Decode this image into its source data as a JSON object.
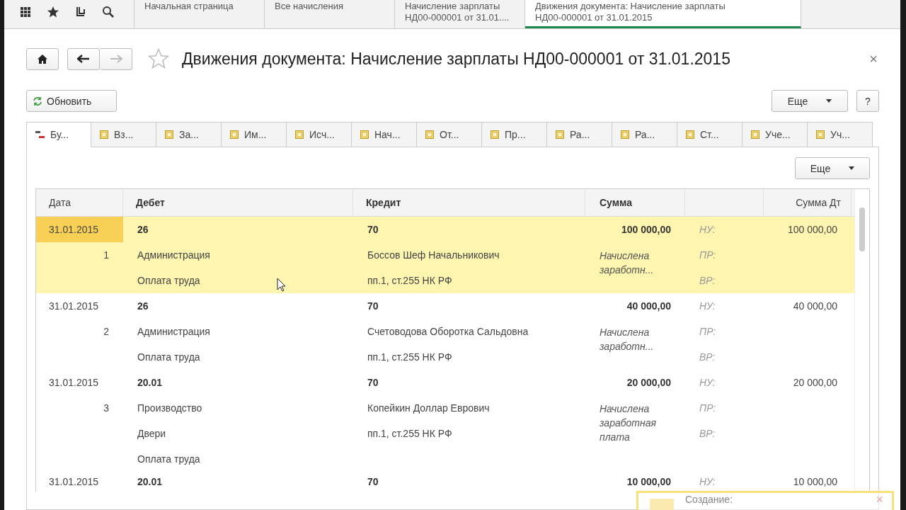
{
  "top_tabs": [
    {
      "lines": [
        "Начальная страница"
      ],
      "selected": false
    },
    {
      "lines": [
        "Все начисления"
      ],
      "selected": false
    },
    {
      "lines": [
        "Начисление зарплаты",
        "НД00-000001 от 31.01...."
      ],
      "selected": false
    },
    {
      "lines": [
        "Движения документа: Начисление зарплаты",
        "НД00-000001 от 31.01.2015"
      ],
      "selected": true
    }
  ],
  "window": {
    "title": "Движения документа: Начисление зарплаты НД00-000001 от 31.01.2015",
    "close": "×"
  },
  "toolbar": {
    "refresh": "Обновить",
    "more": "Еще",
    "help": "?"
  },
  "register_tabs": [
    {
      "label": "Бу...",
      "kind": "accounting",
      "selected": true
    },
    {
      "label": "Вз...",
      "kind": "register",
      "selected": false
    },
    {
      "label": "За...",
      "kind": "register",
      "selected": false
    },
    {
      "label": "Им...",
      "kind": "register",
      "selected": false
    },
    {
      "label": "Исч...",
      "kind": "register",
      "selected": false
    },
    {
      "label": "Нач...",
      "kind": "register",
      "selected": false
    },
    {
      "label": "От...",
      "kind": "register",
      "selected": false
    },
    {
      "label": "Пр...",
      "kind": "register",
      "selected": false
    },
    {
      "label": "Ра...",
      "kind": "register",
      "selected": false
    },
    {
      "label": "Ра...",
      "kind": "register",
      "selected": false
    },
    {
      "label": "Ст...",
      "kind": "register",
      "selected": false
    },
    {
      "label": "Уче...",
      "kind": "register",
      "selected": false
    },
    {
      "label": "Уч...",
      "kind": "register",
      "selected": false
    }
  ],
  "panel": {
    "more": "Еще"
  },
  "table": {
    "columns": [
      "Дата",
      "Дебет",
      "Кредит",
      "Сумма",
      "Сумма Дт"
    ],
    "rows": [
      {
        "date": "31.01.2015",
        "number": "1",
        "debit": [
          "26",
          "Администрация",
          "Оплата труда"
        ],
        "credit": [
          "70",
          "Боссов Шеф Начальникович",
          "пп.1, ст.255 НК РФ"
        ],
        "sum": "100 000,00",
        "content": "Начислена заработн...",
        "tax": [
          "НУ:",
          "ПР:",
          "ВР:"
        ],
        "sum_dt": "100 000,00",
        "selected": true
      },
      {
        "date": "31.01.2015",
        "number": "2",
        "debit": [
          "26",
          "Администрация",
          "Оплата труда"
        ],
        "credit": [
          "70",
          "Счетоводова Оборотка Сальдовна",
          "пп.1, ст.255 НК РФ"
        ],
        "sum": "40 000,00",
        "content": "Начислена заработн...",
        "tax": [
          "НУ:",
          "ПР:",
          "ВР:"
        ],
        "sum_dt": "40 000,00",
        "selected": false
      },
      {
        "date": "31.01.2015",
        "number": "3",
        "debit": [
          "20.01",
          "Производство",
          "Двери",
          "Оплата труда"
        ],
        "credit": [
          "70",
          "Копейкин Доллар Еврович",
          "пп.1, ст.255 НК РФ"
        ],
        "sum": "20 000,00",
        "content": "Начислена заработная плата",
        "tax": [
          "НУ:",
          "ПР:",
          "ВР:"
        ],
        "sum_dt": "20 000,00",
        "selected": false
      },
      {
        "date": "31.01.2015",
        "debit": [
          "20.01"
        ],
        "credit": [
          "70"
        ],
        "sum": "10 000,00",
        "tax": [
          "НУ:"
        ],
        "sum_dt": "10 000,00",
        "selected": false
      }
    ]
  },
  "notification": {
    "title": "Создание:",
    "close": "×"
  }
}
